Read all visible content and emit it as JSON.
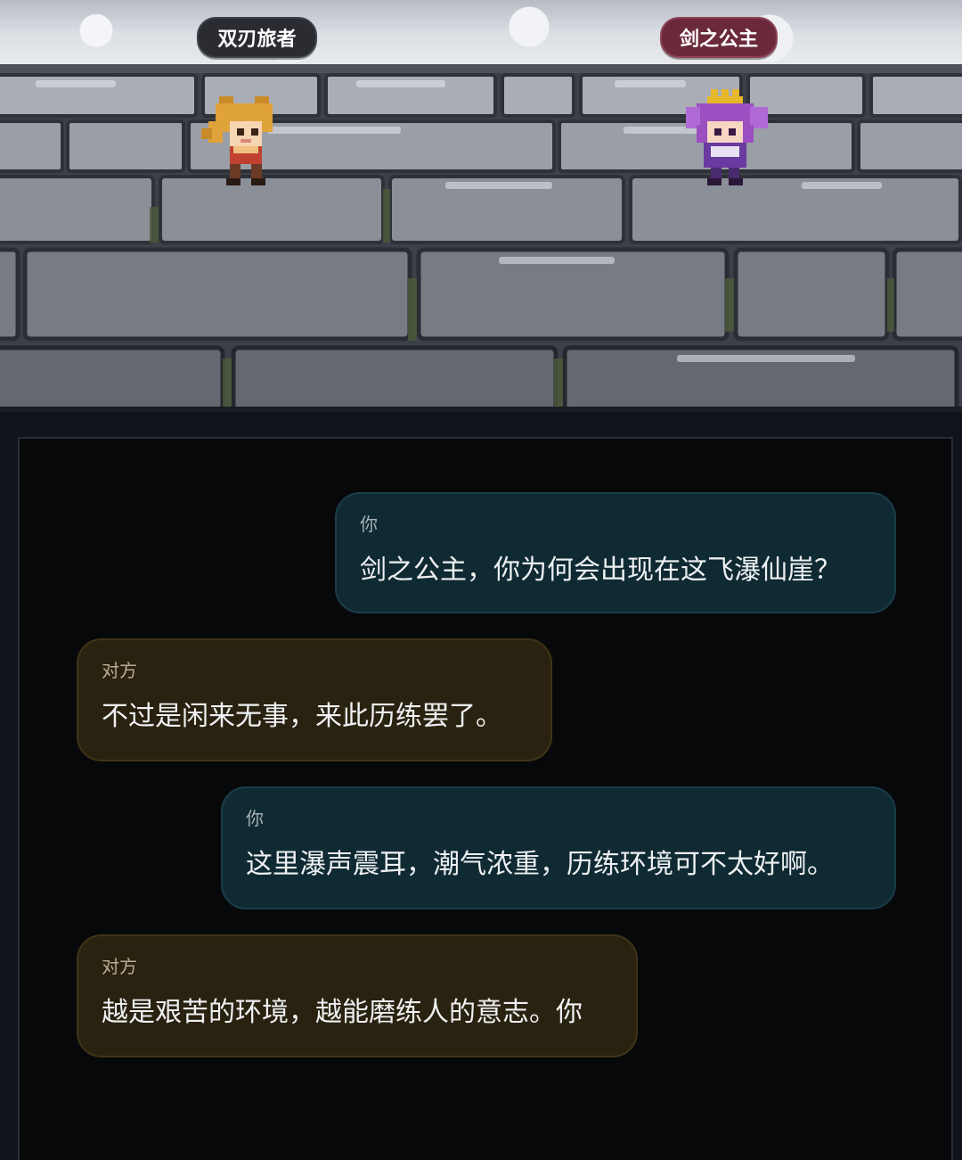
{
  "scene": {
    "player_name": "双刃旅者",
    "npc_name": "剑之公主",
    "colors": {
      "player_tag": "#2a2c32",
      "npc_tag": "#6b2a3c",
      "stone": "#8a8e97",
      "moss": "#4c5a3a"
    }
  },
  "dialogue": [
    {
      "speaker": "你",
      "side": "you",
      "text": "剑之公主，你为何会出现在这飞瀑仙崖？"
    },
    {
      "speaker": "对方",
      "side": "other",
      "text": "不过是闲来无事，来此历练罢了。"
    },
    {
      "speaker": "你",
      "side": "you",
      "text": "这里瀑声震耳，潮气浓重，历练环境可不太好啊。"
    },
    {
      "speaker": "对方",
      "side": "other",
      "text": "越是艰苦的环境，越能磨练人的意志。你"
    }
  ],
  "colors": {
    "bubble_you_bg": "#0f2a33",
    "bubble_other_bg": "#2a2210",
    "panel_bg": "#07080a"
  }
}
